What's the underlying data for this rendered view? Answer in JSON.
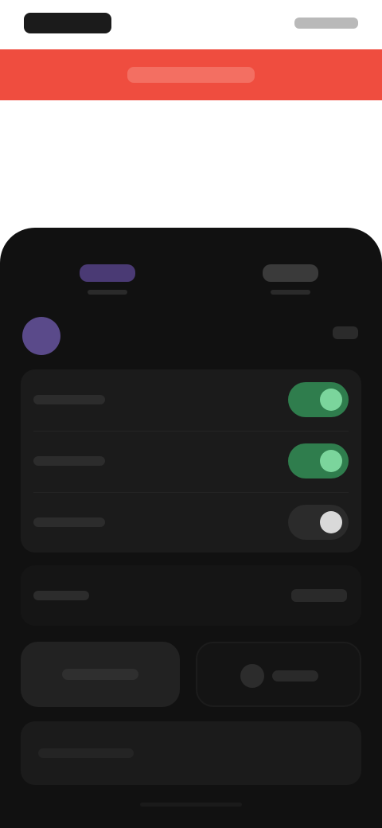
{
  "status_bar": {
    "left_text": "",
    "right_text": ""
  },
  "banner": {
    "text": "",
    "background_color": "#ef4d3f"
  },
  "tabs": [
    {
      "label": ""
    },
    {
      "label": ""
    }
  ],
  "top_actions": {
    "avatar_name": "",
    "right_action_label": ""
  },
  "settings": {
    "items": [
      {
        "label": "",
        "toggle_state": "on"
      },
      {
        "label": "",
        "toggle_state": "on"
      },
      {
        "label": "",
        "toggle_state": "off"
      }
    ],
    "accent_on_color": "#2f7d4d",
    "accent_off_color": "#2b2b2b"
  },
  "info_row": {
    "label": "",
    "value": ""
  },
  "buttons": {
    "left_label": "",
    "right_label": "",
    "right_icon": "record-icon"
  },
  "bottom_card": {
    "label": ""
  },
  "colors": {
    "sheet_background": "#111111",
    "panel_background": "#1b1b1b"
  }
}
